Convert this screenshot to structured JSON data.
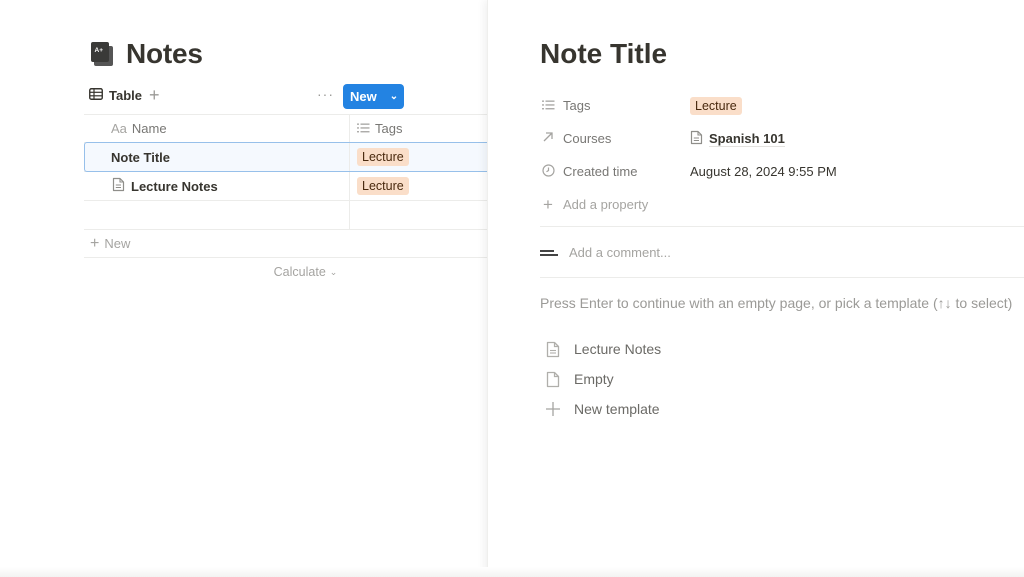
{
  "database": {
    "title": "Notes",
    "icon": "book-icon",
    "view": {
      "label": "Table",
      "icon": "table-icon"
    },
    "actions": {
      "more": "···",
      "new_label": "New"
    },
    "columns": [
      {
        "label": "Name",
        "icon_text": "Aa"
      },
      {
        "label": "Tags",
        "icon": "list-icon"
      }
    ],
    "rows": [
      {
        "name": "Note Title",
        "tag": "Lecture",
        "selected": true,
        "has_doc_icon": false
      },
      {
        "name": "Lecture Notes",
        "tag": "Lecture",
        "selected": false,
        "has_doc_icon": true
      }
    ],
    "add_row_label": "New",
    "calculate_label": "Calculate"
  },
  "page": {
    "title": "Note Title",
    "properties": [
      {
        "label": "Tags",
        "icon": "list-icon",
        "value": "Lecture",
        "type": "tag"
      },
      {
        "label": "Courses",
        "icon": "arrow-up-right-icon",
        "value": "Spanish 101",
        "type": "relation"
      },
      {
        "label": "Created time",
        "icon": "clock-icon",
        "value": "August 28, 2024 9:55 PM",
        "type": "text"
      }
    ],
    "add_property_label": "Add a property",
    "comment_placeholder": "Add a comment...",
    "template_hint": "Press Enter to continue with an empty page, or pick a template (↑↓ to select)",
    "templates": [
      {
        "label": "Lecture Notes",
        "icon": "document-icon"
      },
      {
        "label": "Empty",
        "icon": "blank-page-icon"
      },
      {
        "label": "New template",
        "icon": "plus-icon"
      }
    ]
  },
  "colors": {
    "accent": "#2383e2",
    "tag_bg": "#fadec9",
    "tag_text": "#49290e",
    "selection_border": "#97c0ea"
  }
}
